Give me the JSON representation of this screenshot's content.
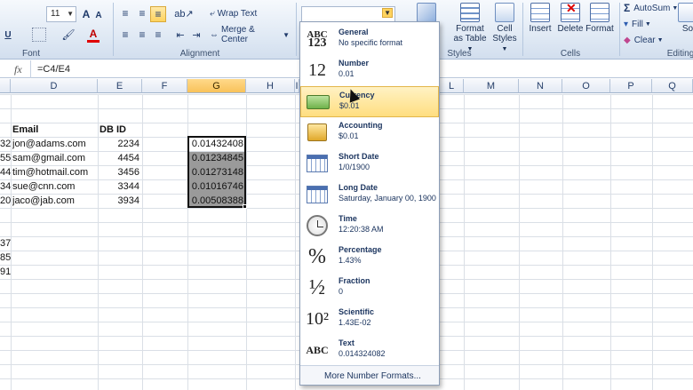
{
  "ribbon": {
    "font_size": "11",
    "wrap_text_label": "Wrap Text",
    "merge_center_label": "Merge & Center",
    "font_group_label": "Font",
    "alignment_group_label": "Alignment",
    "styles_group_label": "Styles",
    "cells_group_label": "Cells",
    "editing_group_label": "Editing",
    "format_as_table_label1": "Format",
    "format_as_table_label2": "as Table",
    "cell_styles_label1": "Cell",
    "cell_styles_label2": "Styles",
    "insert_label": "Insert",
    "delete_label": "Delete",
    "format_label": "Format",
    "autosum_label": "AutoSum",
    "fill_label": "Fill",
    "clear_label": "Clear",
    "sort_label": "So"
  },
  "formula_bar": {
    "fx": "fx",
    "formula": "=C4/E4"
  },
  "columns": [
    "D",
    "E",
    "F",
    "G",
    "H",
    "I",
    "L",
    "M",
    "N",
    "O",
    "P",
    "Q"
  ],
  "sheet": {
    "header_email": "Email",
    "header_dbid": "DB ID",
    "rows": [
      {
        "prefix": "32",
        "email": "jon@adams.com",
        "dbid": "2234",
        "g": "0.01432408"
      },
      {
        "prefix": "55",
        "email": "sam@gmail.com",
        "dbid": "4454",
        "g": "0.01234845"
      },
      {
        "prefix": "44",
        "email": "tim@hotmail.com",
        "dbid": "3456",
        "g": "0.01273148"
      },
      {
        "prefix": "34",
        "email": "sue@cnn.com",
        "dbid": "3344",
        "g": "0.01016746"
      },
      {
        "prefix": "20",
        "email": "jaco@jab.com",
        "dbid": "3934",
        "g": "0.00508388"
      }
    ],
    "extra_prefixes": [
      "37",
      "85",
      "91"
    ]
  },
  "number_format_menu": {
    "items": [
      {
        "title": "General",
        "sub": "No specific format",
        "icon": "ABC\n123"
      },
      {
        "title": "Number",
        "sub": "0.01",
        "icon": "12"
      },
      {
        "title": "Currency",
        "sub": "$0.01",
        "icon": ""
      },
      {
        "title": "Accounting",
        "sub": "$0.01",
        "icon": ""
      },
      {
        "title": "Short Date",
        "sub": "1/0/1900",
        "icon": ""
      },
      {
        "title": "Long Date",
        "sub": "Saturday, January 00, 1900",
        "icon": ""
      },
      {
        "title": "Time",
        "sub": "12:20:38 AM",
        "icon": ""
      },
      {
        "title": "Percentage",
        "sub": "1.43%",
        "icon": "%"
      },
      {
        "title": "Fraction",
        "sub": "0",
        "icon": "½"
      },
      {
        "title": "Scientific",
        "sub": "1.43E-02",
        "icon": "10²"
      },
      {
        "title": "Text",
        "sub": "0.014324082",
        "icon": "ABC"
      }
    ],
    "more_label": "More Number Formats..."
  }
}
